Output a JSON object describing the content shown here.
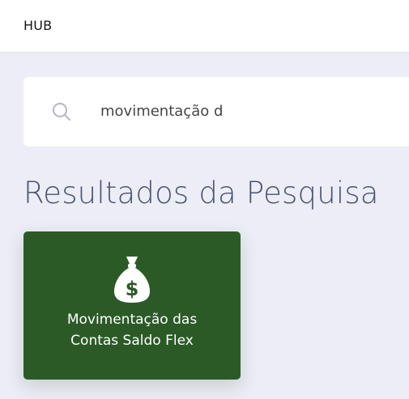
{
  "header": {
    "title": "HUB"
  },
  "search": {
    "value": "movimentação d",
    "icon": "search-icon"
  },
  "results": {
    "title": "Resultados da Pesquisa",
    "items": [
      {
        "icon": "money-bag-icon",
        "label_line1": "Movimentação das",
        "label_line2": "Contas Saldo Flex",
        "color": "#2b5a27"
      }
    ]
  },
  "colors": {
    "background": "#ecedf6",
    "card_green": "#2b5a27",
    "title_text": "#4a5470"
  }
}
